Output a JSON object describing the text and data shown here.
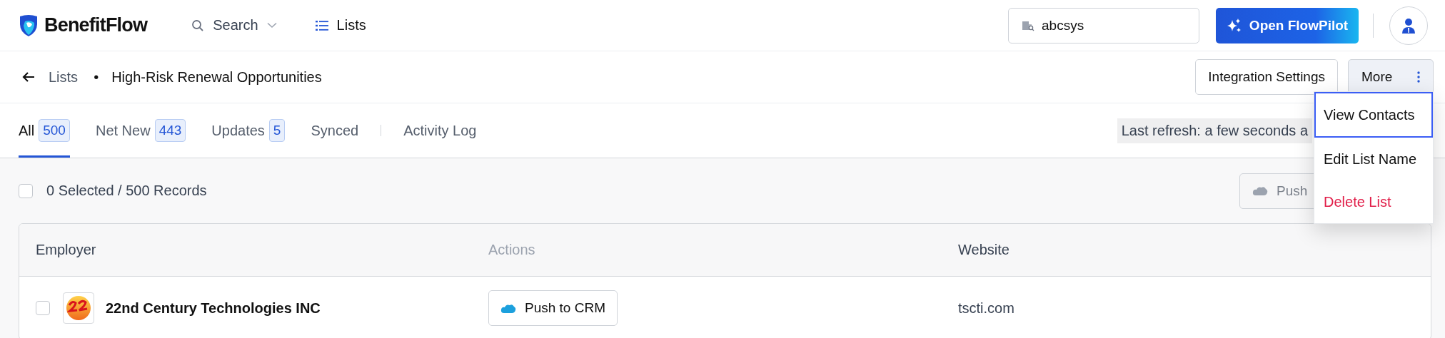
{
  "header": {
    "brand": "BenefitFlow",
    "nav": [
      {
        "label": "Search",
        "kind": "search",
        "selected": false
      },
      {
        "label": "Lists",
        "kind": "lists",
        "selected": true
      }
    ],
    "search_field": {
      "value": "abcsys"
    },
    "assistant_button": "Open FlowPilot"
  },
  "breadcrumb": {
    "parent": "Lists",
    "separator": "•",
    "title": "High-Risk Renewal Opportunities"
  },
  "integration_button": "Integration Settings",
  "more_button": {
    "label": "More",
    "expanded": true
  },
  "menu": [
    {
      "label": "View Contacts",
      "kind": "normal",
      "focused": true
    },
    {
      "label": "Edit List Name",
      "kind": "normal",
      "focused": false
    },
    {
      "label": "Delete List",
      "kind": "danger",
      "focused": false
    }
  ],
  "tabs": [
    {
      "label": "All",
      "count": "500",
      "selected": true,
      "divider_before": false
    },
    {
      "label": "Net New",
      "count": "443",
      "selected": false,
      "divider_before": false
    },
    {
      "label": "Updates",
      "count": "5",
      "selected": false,
      "divider_before": false
    },
    {
      "label": "Synced",
      "selected": false,
      "divider_before": false
    },
    {
      "label": "Activity Log",
      "selected": false,
      "divider_before": true
    }
  ],
  "last_refresh": "Last refresh: a few seconds a",
  "selection": {
    "checked": false,
    "summary": "0 Selected / 500 Records"
  },
  "bulk_push_button": {
    "label": "Push",
    "disabled": true
  },
  "table": {
    "columns": [
      {
        "label": "Employer",
        "muted": false
      },
      {
        "label": "Actions",
        "muted": true
      },
      {
        "label": "Website",
        "muted": false
      }
    ],
    "rows": [
      {
        "checked": false,
        "employer": "22nd Century Technologies INC",
        "action": "Push to CRM",
        "website": "tscti.com"
      }
    ]
  }
}
